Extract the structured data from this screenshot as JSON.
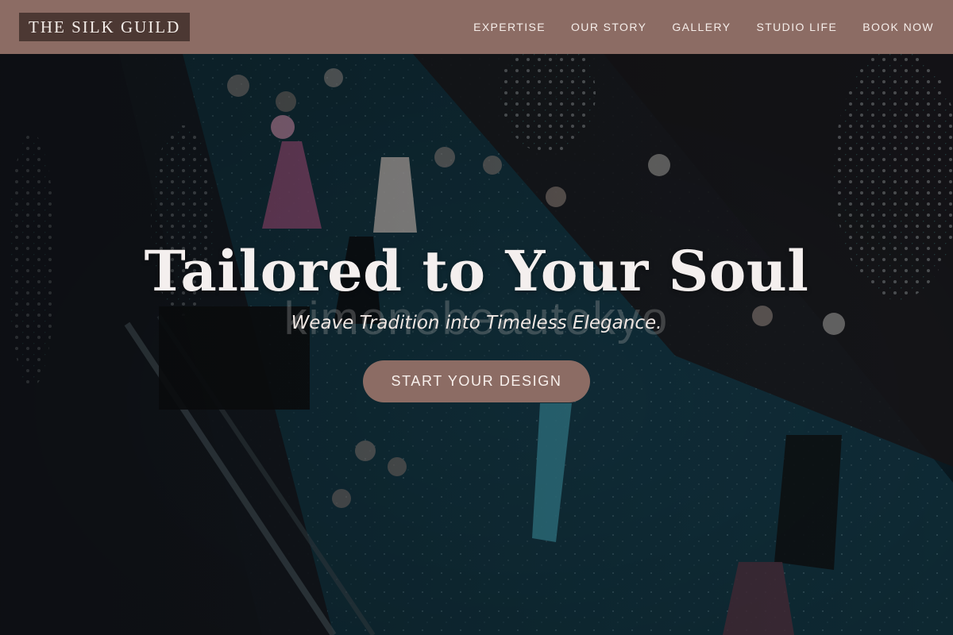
{
  "brand": {
    "logo_text": "THE SILK GUILD",
    "nav_bg": "#8c6c64",
    "logo_bg": "#4c3833"
  },
  "nav": {
    "items": [
      {
        "label": "EXPERTISE"
      },
      {
        "label": "OUR STORY"
      },
      {
        "label": "GALLERY"
      },
      {
        "label": "STUDIO LIFE"
      },
      {
        "label": "BOOK NOW"
      }
    ]
  },
  "hero": {
    "headline": "Tailored to Your Soul",
    "subheadline": "Weave Tradition into Timeless Elegance.",
    "watermark": "kimonobeautokyo",
    "cta_label": "START YOUR DESIGN",
    "cta_color": "#8c6c64",
    "background_description": "fashion-runway-photo"
  }
}
